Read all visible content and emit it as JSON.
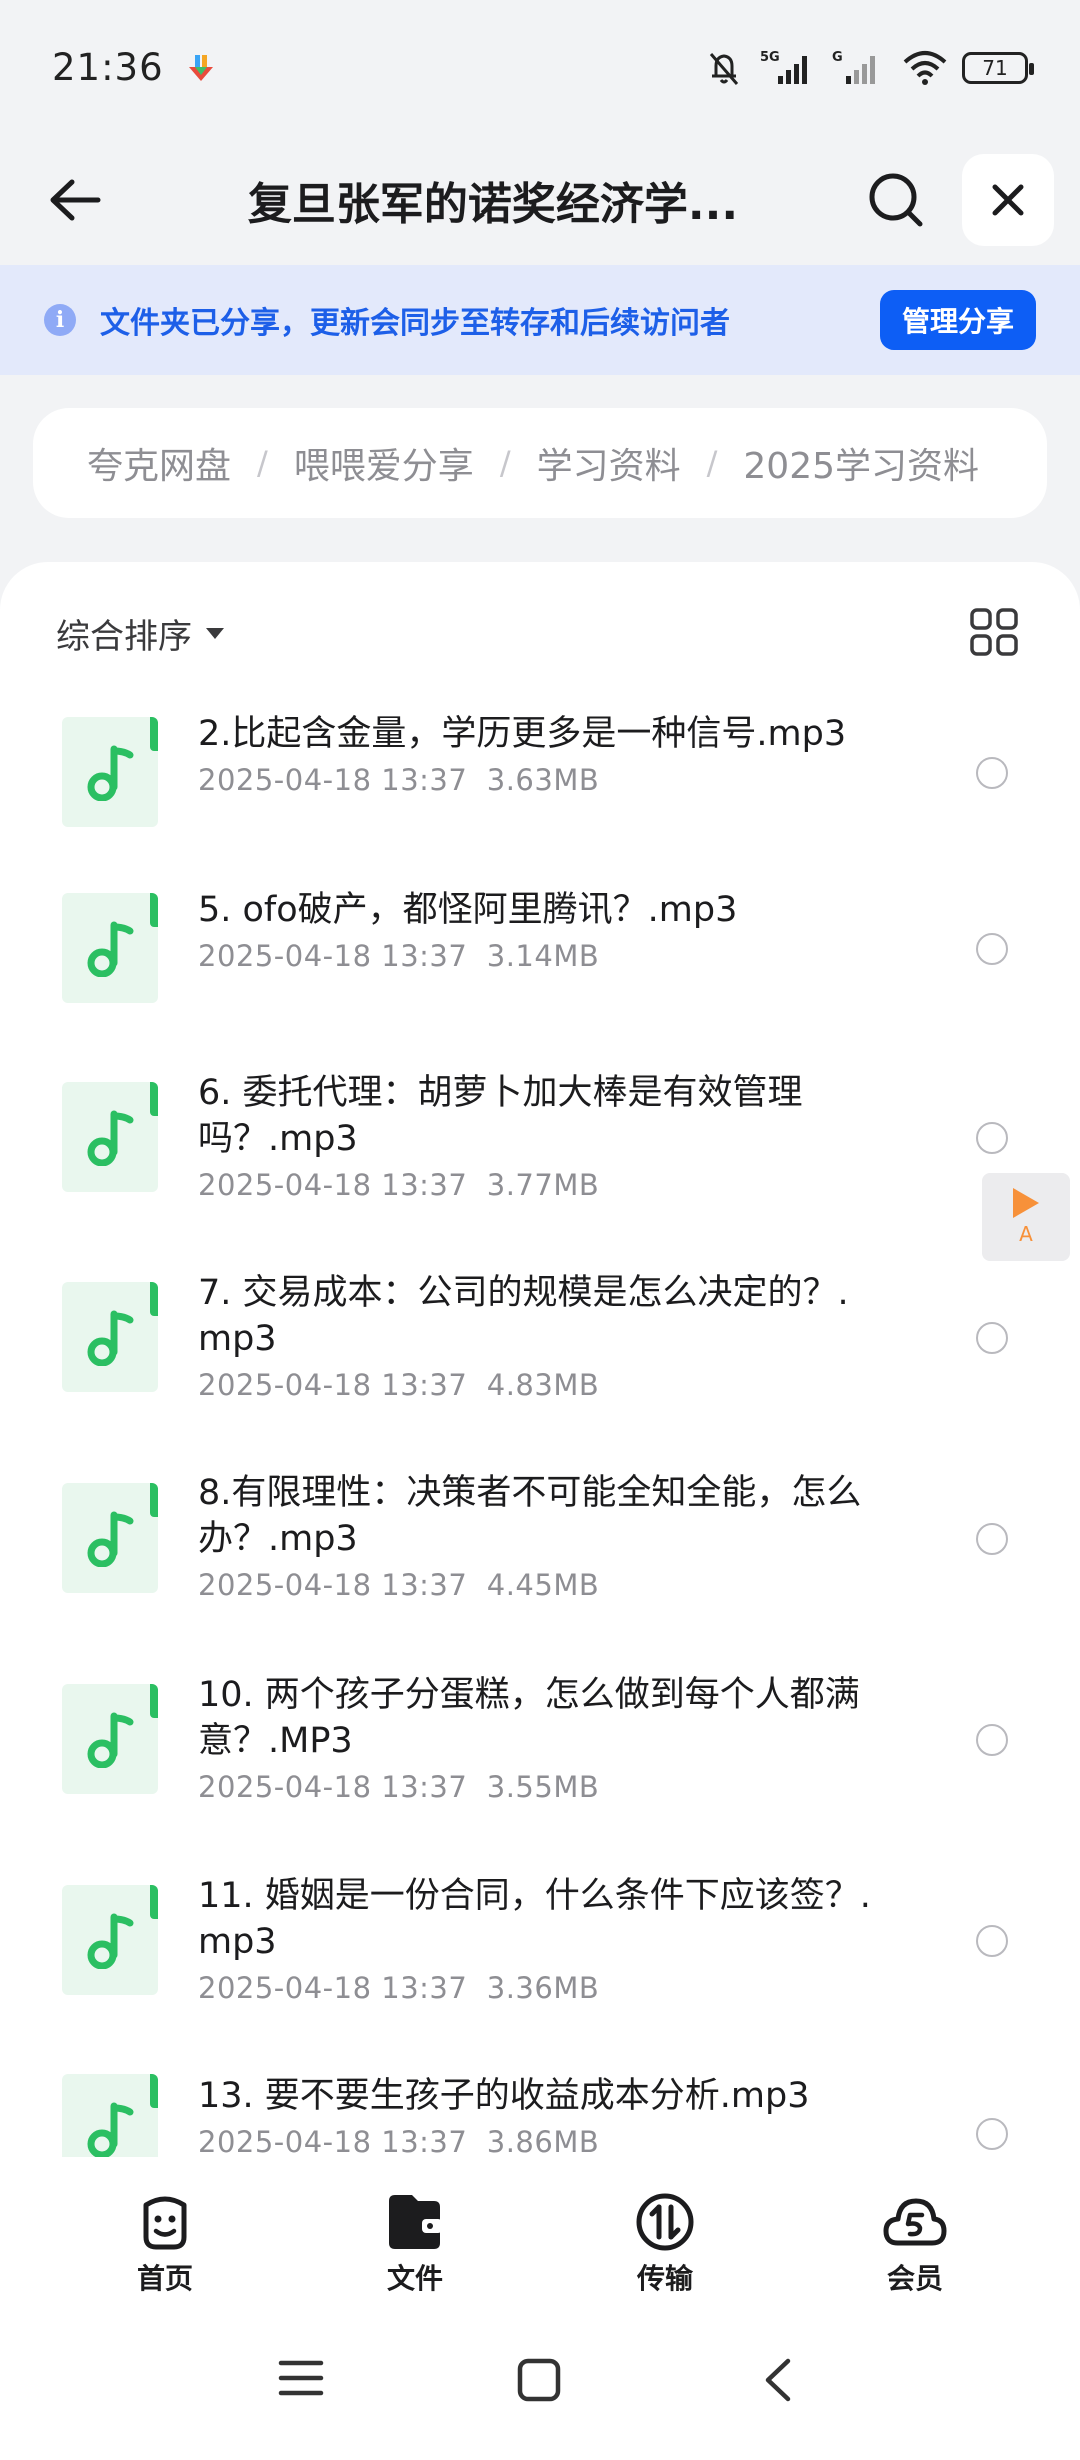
{
  "status_bar": {
    "time": "21:36",
    "network_1": "5G",
    "network_2": "G",
    "battery": "71"
  },
  "header": {
    "title": "复旦张军的诺奖经济学..."
  },
  "banner": {
    "text": "文件夹已分享，更新会同步至转存和后续访问者",
    "button": "管理分享"
  },
  "breadcrumb": [
    "夸克网盘",
    "喂喂爱分享",
    "学习资料",
    "2025学习资料"
  ],
  "toolbar": {
    "sort_label": "综合排序"
  },
  "files": [
    {
      "name": "2.比起含金量，学历更多是一种信号.mp3",
      "date": "2025-04-18 13:37",
      "size": "3.63MB"
    },
    {
      "name": "5. ofo破产，都怪阿里腾讯？.mp3",
      "date": "2025-04-18 13:37",
      "size": "3.14MB"
    },
    {
      "name": "6. 委托代理：胡萝卜加大棒是有效管理吗？.mp3",
      "date": "2025-04-18 13:37",
      "size": "3.77MB"
    },
    {
      "name": "7. 交易成本：公司的规模是怎么决定的？.mp3",
      "date": "2025-04-18 13:37",
      "size": "4.83MB"
    },
    {
      "name": "8.有限理性：决策者不可能全知全能，怎么办？.mp3",
      "date": "2025-04-18 13:37",
      "size": "4.45MB"
    },
    {
      "name": "10. 两个孩子分蛋糕，怎么做到每个人都满意？.MP3",
      "date": "2025-04-18 13:37",
      "size": "3.55MB"
    },
    {
      "name": "11. 婚姻是一份合同，什么条件下应该签？.mp3",
      "date": "2025-04-18 13:37",
      "size": "3.36MB"
    },
    {
      "name": "13. 要不要生孩子的收益成本分析.mp3",
      "date": "2025-04-18 13:37",
      "size": "3.86MB"
    }
  ],
  "float_button": {
    "label": "A"
  },
  "bottom_nav": [
    {
      "label": "首页",
      "icon": "smile-face-icon"
    },
    {
      "label": "文件",
      "icon": "folder-icon"
    },
    {
      "label": "传输",
      "icon": "transfer-icon"
    },
    {
      "label": "会员",
      "icon": "cloud-vip-icon"
    }
  ]
}
